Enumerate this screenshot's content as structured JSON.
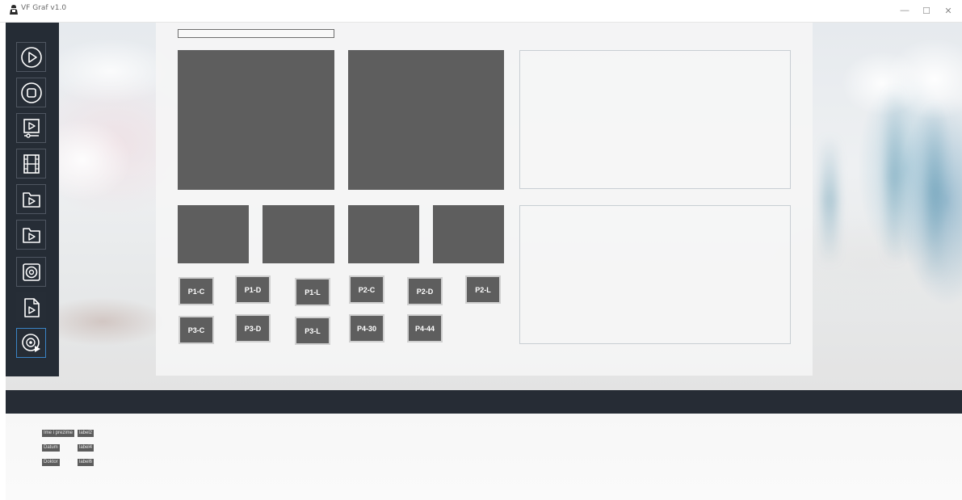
{
  "window": {
    "title": "VF Graf v1.0",
    "controls": {
      "minimize": "—",
      "maximize": "☐",
      "close": "✕"
    }
  },
  "sidebar": {
    "buttons": [
      {
        "name": "play-circle",
        "icon": "play-circle-icon"
      },
      {
        "name": "stop-circle",
        "icon": "stop-circle-icon"
      },
      {
        "name": "video-player",
        "icon": "video-player-icon"
      },
      {
        "name": "film-strip",
        "icon": "film-strip-icon"
      },
      {
        "name": "folder-play-1",
        "icon": "folder-play-icon"
      },
      {
        "name": "folder-play-2",
        "icon": "folder-play-icon"
      },
      {
        "name": "record-disc",
        "icon": "disc-icon"
      },
      {
        "name": "play-file",
        "icon": "file-play-icon"
      },
      {
        "name": "disc-play",
        "icon": "disc-play-icon",
        "active": true
      }
    ],
    "active_border_color": "#3a84c6"
  },
  "panel": {
    "path_value": "",
    "preset_buttons": {
      "row1": [
        "P1-C",
        "P1-D",
        "P1-L",
        "P2-C",
        "P2-D",
        "P2-L"
      ],
      "row2": [
        "P3-C",
        "P3-D",
        "P3-L",
        "P4-30",
        "P4-44"
      ]
    }
  },
  "info": {
    "name_caption": "Ime i prezime",
    "name_value": "label2",
    "date_caption": "Datum",
    "date_value": "label4",
    "doctor_caption": "Doktor",
    "doctor_value": "label6"
  },
  "colors": {
    "sidebar_bg": "#252c35",
    "video_placeholder": "#5e5e5e",
    "strip_bg": "#262c35"
  }
}
